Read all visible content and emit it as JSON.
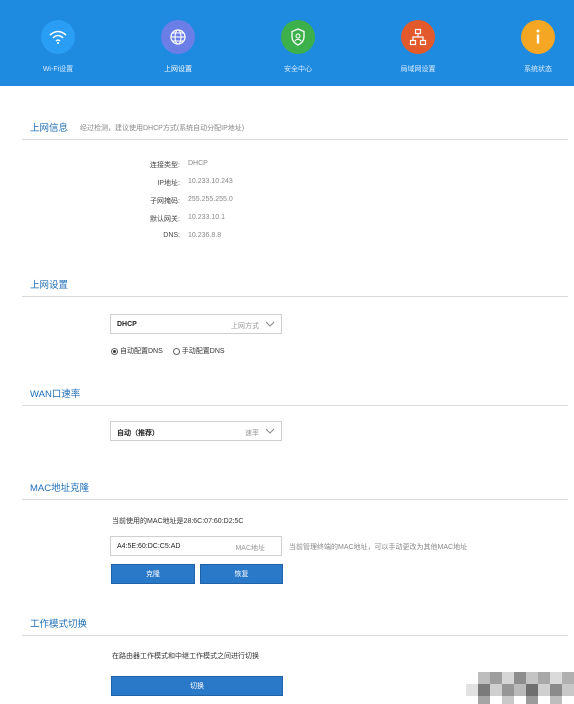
{
  "nav": {
    "items": [
      {
        "label": "Wi-Fi设置",
        "icon": "wifi-icon",
        "color": "#2a9df4"
      },
      {
        "label": "上网设置",
        "icon": "globe-icon",
        "color": "#6b7ee8"
      },
      {
        "label": "安全中心",
        "icon": "shield-icon",
        "color": "#3cb04a"
      },
      {
        "label": "局域网设置",
        "icon": "network-icon",
        "color": "#e2592c"
      },
      {
        "label": "系统状态",
        "icon": "info-icon",
        "color": "#f5a623"
      }
    ],
    "active_index": 1,
    "bar_color": "#1e8ae0"
  },
  "internet_info": {
    "title": "上网信息",
    "note": "经过检测，建议使用DHCP方式(系统自动分配IP地址)",
    "rows": [
      {
        "label": "连接类型:",
        "value": "DHCP"
      },
      {
        "label": "IP地址:",
        "value": "10.233.10.243"
      },
      {
        "label": "子网掩码:",
        "value": "255.255.255.0"
      },
      {
        "label": "默认网关:",
        "value": "10.233.10.1"
      },
      {
        "label": "DNS:",
        "value": "10.236.8.8"
      }
    ]
  },
  "internet_settings": {
    "title": "上网设置",
    "mode_select": {
      "value": "DHCP",
      "hint": "上网方式"
    },
    "dns_auto_label": "自动配置DNS",
    "dns_manual_label": "手动配置DNS",
    "dns_auto_checked": true
  },
  "wan_speed": {
    "title": "WAN口速率",
    "select": {
      "value": "自动（推荐）",
      "hint": "速率"
    }
  },
  "mac_clone": {
    "title": "MAC地址克隆",
    "current_text": "当前使用的MAC地址是28:6C:07:60:D2:5C",
    "input_value": "A4:5E:60:DC:C5:AD",
    "input_hint": "MAC地址",
    "side_hint": "当前管理终端的MAC地址，可以手动更改为其他MAC地址",
    "clone_label": "克隆",
    "restore_label": "恢复"
  },
  "work_mode": {
    "title": "工作模式切换",
    "description": "在路由器工作模式和中继工作模式之间进行切换",
    "switch_label": "切换"
  },
  "accent_color": "#2a78c8"
}
